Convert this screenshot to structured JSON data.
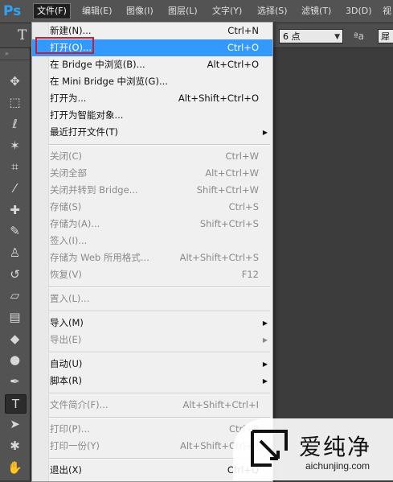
{
  "app": {
    "logo": "Ps"
  },
  "menubar": {
    "items": [
      {
        "label": "文件(F)",
        "active": true
      },
      {
        "label": "编辑(E)"
      },
      {
        "label": "图像(I)"
      },
      {
        "label": "图层(L)"
      },
      {
        "label": "文字(Y)"
      },
      {
        "label": "选择(S)"
      },
      {
        "label": "滤镜(T)"
      },
      {
        "label": "3D(D)"
      },
      {
        "label": "视"
      }
    ]
  },
  "options_bar": {
    "tool_glyph": "T",
    "font_size": "6 点",
    "aa_glyph": "ªa",
    "right_field": "犀"
  },
  "file_menu": {
    "groups": [
      [
        {
          "label": "新建(N)...",
          "shortcut": "Ctrl+N"
        },
        {
          "label": "打开(O)...",
          "shortcut": "Ctrl+O",
          "highlight": true
        },
        {
          "label": "在 Bridge 中浏览(B)...",
          "shortcut": "Alt+Ctrl+O"
        },
        {
          "label": "在 Mini Bridge 中浏览(G)...",
          "shortcut": ""
        },
        {
          "label": "打开为...",
          "shortcut": "Alt+Shift+Ctrl+O"
        },
        {
          "label": "打开为智能对象...",
          "shortcut": ""
        },
        {
          "label": "最近打开文件(T)",
          "shortcut": "",
          "submenu": true
        }
      ],
      [
        {
          "label": "关闭(C)",
          "shortcut": "Ctrl+W",
          "disabled": true
        },
        {
          "label": "关闭全部",
          "shortcut": "Alt+Ctrl+W",
          "disabled": true
        },
        {
          "label": "关闭并转到 Bridge...",
          "shortcut": "Shift+Ctrl+W",
          "disabled": true
        },
        {
          "label": "存储(S)",
          "shortcut": "Ctrl+S",
          "disabled": true
        },
        {
          "label": "存储为(A)...",
          "shortcut": "Shift+Ctrl+S",
          "disabled": true
        },
        {
          "label": "签入(I)...",
          "shortcut": "",
          "disabled": true
        },
        {
          "label": "存储为 Web 所用格式...",
          "shortcut": "Alt+Shift+Ctrl+S",
          "disabled": true
        },
        {
          "label": "恢复(V)",
          "shortcut": "F12",
          "disabled": true
        }
      ],
      [
        {
          "label": "置入(L)...",
          "shortcut": "",
          "disabled": true
        }
      ],
      [
        {
          "label": "导入(M)",
          "shortcut": "",
          "submenu": true
        },
        {
          "label": "导出(E)",
          "shortcut": "",
          "submenu": true,
          "disabled": true
        }
      ],
      [
        {
          "label": "自动(U)",
          "shortcut": "",
          "submenu": true
        },
        {
          "label": "脚本(R)",
          "shortcut": "",
          "submenu": true
        }
      ],
      [
        {
          "label": "文件简介(F)...",
          "shortcut": "Alt+Shift+Ctrl+I",
          "disabled": true
        }
      ],
      [
        {
          "label": "打印(P)...",
          "shortcut": "Ctrl+P",
          "disabled": true
        },
        {
          "label": "打印一份(Y)",
          "shortcut": "Alt+Shift+Ctrl+P",
          "disabled": true
        }
      ],
      [
        {
          "label": "退出(X)",
          "shortcut": "Ctrl+Q"
        }
      ]
    ]
  },
  "toolbar": {
    "tools": [
      {
        "name": "move-tool-icon",
        "glyph": "✥"
      },
      {
        "name": "marquee-tool-icon",
        "glyph": "⬚"
      },
      {
        "name": "lasso-tool-icon",
        "glyph": "ℓ"
      },
      {
        "name": "magic-wand-tool-icon",
        "glyph": "✶"
      },
      {
        "name": "crop-tool-icon",
        "glyph": "⌗"
      },
      {
        "name": "eyedropper-tool-icon",
        "glyph": "⁄"
      },
      {
        "name": "healing-brush-tool-icon",
        "glyph": "✚"
      },
      {
        "name": "brush-tool-icon",
        "glyph": "✎"
      },
      {
        "name": "stamp-tool-icon",
        "glyph": "♙"
      },
      {
        "name": "history-brush-tool-icon",
        "glyph": "↺"
      },
      {
        "name": "eraser-tool-icon",
        "glyph": "▱"
      },
      {
        "name": "gradient-tool-icon",
        "glyph": "▤"
      },
      {
        "name": "blur-tool-icon",
        "glyph": "◆"
      },
      {
        "name": "dodge-tool-icon",
        "glyph": "●"
      },
      {
        "name": "pen-tool-icon",
        "glyph": "✒"
      },
      {
        "name": "type-tool-icon",
        "glyph": "T",
        "active": true
      },
      {
        "name": "path-selection-tool-icon",
        "glyph": "➤"
      },
      {
        "name": "shape-tool-icon",
        "glyph": "✱"
      },
      {
        "name": "hand-tool-icon",
        "glyph": "✋"
      }
    ]
  },
  "watermark": {
    "title": "爱纯净",
    "subtitle": "aichunjing.com"
  },
  "colors": {
    "highlight": "#3399ff",
    "callout_border": "#c0203a",
    "ps_blue": "#2fa3f5"
  }
}
